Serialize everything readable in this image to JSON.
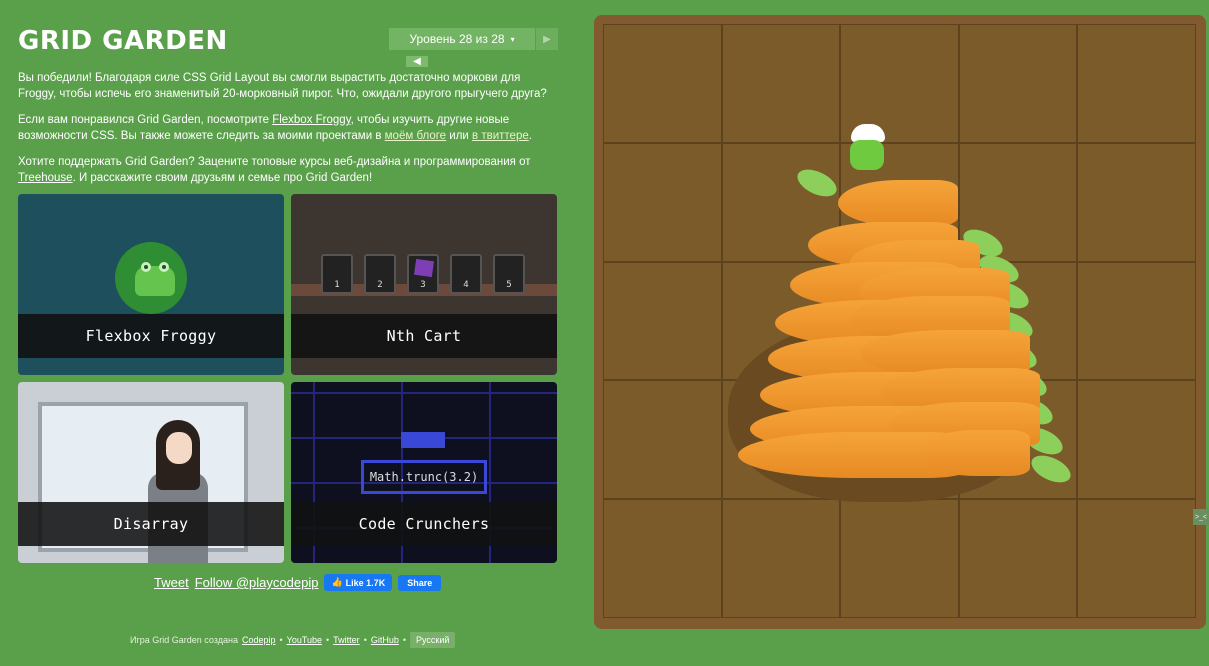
{
  "header": {
    "title": "GRID GARDEN",
    "level_label": "Уровень 28 из 28",
    "prev_arrow": "◀",
    "next_arrow": "▶",
    "caret": "▾"
  },
  "intro": {
    "p1": "Вы победили! Благодаря силе CSS Grid Layout вы смогли вырастить достаточно моркови для Froggy, чтобы испечь его знаменитый 20-морковный пирог. Что, ожидали другого прыгучего друга?",
    "p2_a": "Если вам понравился Grid Garden, посмотрите ",
    "p2_link1": "Flexbox Froggy",
    "p2_b": ", чтобы изучить другие новые возможности CSS. Вы также можете следить за моими проектами в ",
    "p2_link2": "моём блоге",
    "p2_c": " или ",
    "p2_link3": "в твиттере",
    "p2_d": ".",
    "p3_a": "Хотите поддержать Grid Garden? Зацените топовые курсы веб-дизайна и программирования от ",
    "p3_link": "Treehouse",
    "p3_b": ". И расскажите своим друзьям и семье про Grid Garden!"
  },
  "cards": [
    {
      "label": "Flexbox Froggy"
    },
    {
      "label": "Nth Cart"
    },
    {
      "label": "Disarray"
    },
    {
      "label": "Code Crunchers"
    }
  ],
  "nth_cart": {
    "carts": [
      "1",
      "2",
      "3",
      "4",
      "5"
    ]
  },
  "code_crunchers": {
    "code": "Math.trunc(3.2)"
  },
  "social": {
    "tweet": "Tweet",
    "follow": "Follow @playcodepip",
    "like": "Like 1.7K",
    "share": "Share"
  },
  "footer": {
    "text": "Игра Grid Garden создана",
    "links": [
      "Codepip",
      "YouTube",
      "Twitter",
      "GitHub"
    ],
    "separator": "•",
    "language": "Русский"
  },
  "side_tab": ">_<",
  "colors": {
    "background": "#5aa04a",
    "garden_border": "#825a2f",
    "soil": "#7c5b2b",
    "carrot": "#f5a43a",
    "leaf": "#8ccf5b"
  }
}
